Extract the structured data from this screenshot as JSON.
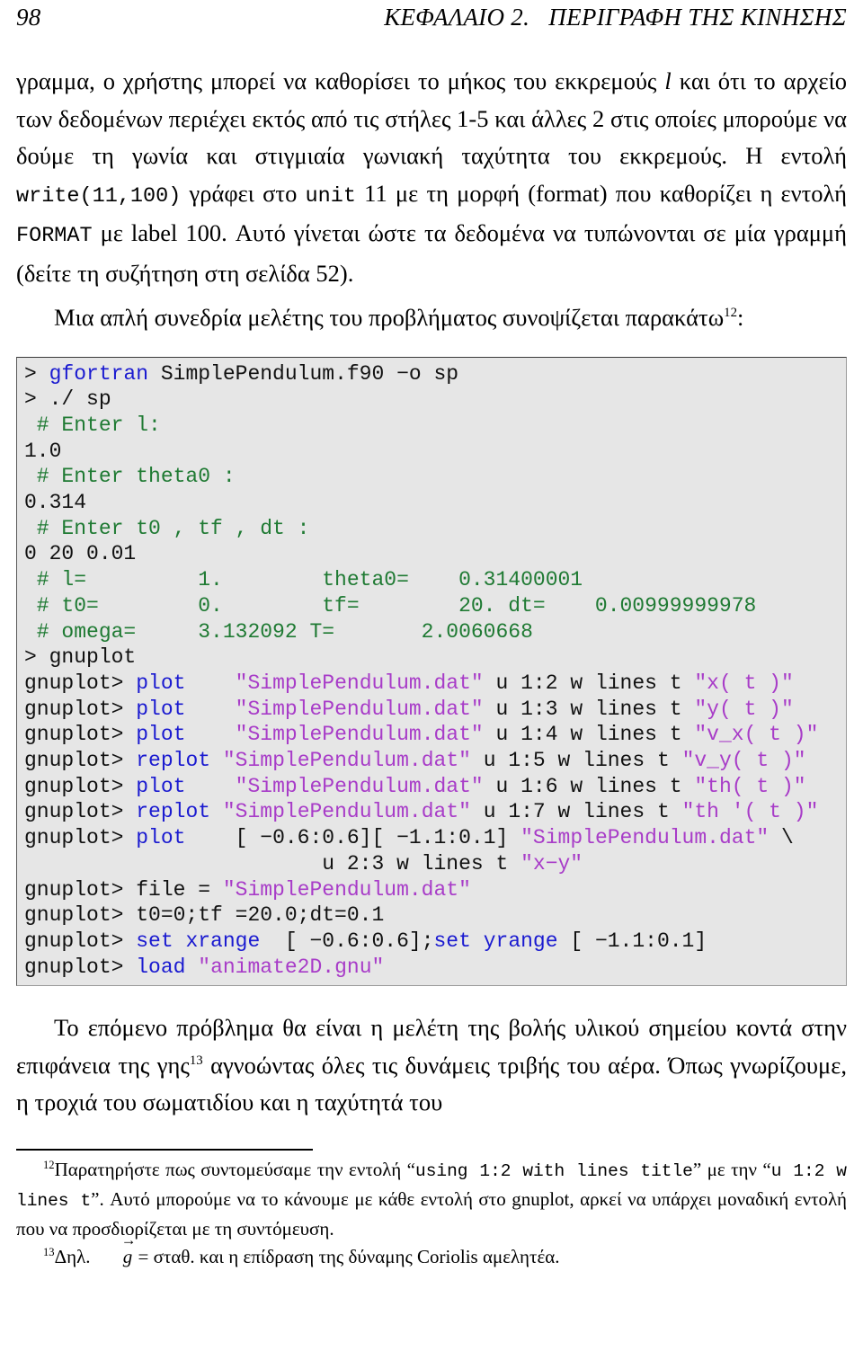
{
  "header": {
    "folio": "98",
    "chapter_title": "ΚΕΦΑΛΑΙΟ 2.   ΠΕΡΙΓΡΑΦΗ ΤΗΣ ΚΙΝΗΣΗΣ"
  },
  "body": {
    "para1_a": "γραμμα, ο χρήστης μπορεί να καθορίσει το μήκος του εκκρεμούς ",
    "para1_l": "l",
    "para1_b": " και ότι το αρχείο των δεδομένων περιέχει εκτός από τις στήλες 1-5 και άλλες 2 στις οποίες μπορούμε να δούμε τη γωνία και στιγμιαία γωνιακή ταχύτητα του εκκρεμούς. Η εντολή ",
    "para1_code1": "write(11,100)",
    "para1_c": " γράφει στο ",
    "para1_code2": "unit",
    "para1_d": " 11 με τη μορφή (format) που καθορίζει η εντολή ",
    "para1_code3": "FORMAT",
    "para1_e": " με label 100. Αυτό γίνεται ώστε τα δεδομένα να τυπώνονται σε μία γραμμή (δείτε τη συζήτηση στη σελίδα 52).",
    "para2_a": "Μια απλή συνεδρία μελέτης του προβλήματος συνοψίζεται παρακάτω",
    "para2_fn": "12",
    "para2_b": ":",
    "para3": "Το επόμενο πρόβλημα θα είναι η μελέτη της βολής υλικού σημείου κοντά στην επιφάνεια της γης",
    "para3_fn": "13",
    "para3_b": " αγνοώντας όλες τις δυνάμεις τριβής του αέρα. Όπως γνωρίζουμε, η τροχιά του σωματιδίου και η ταχύτητά του"
  },
  "code": {
    "lines": [
      [
        {
          "t": "> ",
          "c": "plain"
        },
        {
          "t": "gfortran",
          "c": "kw"
        },
        {
          "t": " SimplePendulum.f90 −o sp",
          "c": "plain"
        }
      ],
      [
        {
          "t": "> ./ sp",
          "c": "plain"
        }
      ],
      [
        {
          "t": " # Enter l:",
          "c": "cmt"
        }
      ],
      [
        {
          "t": "1.0",
          "c": "plain"
        }
      ],
      [
        {
          "t": " # Enter theta0 :",
          "c": "cmt"
        }
      ],
      [
        {
          "t": "0.314",
          "c": "plain"
        }
      ],
      [
        {
          "t": " # Enter t0 , tf , dt :",
          "c": "cmt"
        }
      ],
      [
        {
          "t": "0 20 0.01",
          "c": "plain"
        }
      ],
      [
        {
          "t": " # l=         1.        theta0=    0.31400001",
          "c": "cmt"
        }
      ],
      [
        {
          "t": " # t0=        0.        tf=        20. dt=    0.00999999978",
          "c": "cmt"
        }
      ],
      [
        {
          "t": " # omega=     3.132092 T=       2.0060668",
          "c": "cmt"
        }
      ],
      [
        {
          "t": "> gnuplot",
          "c": "plain"
        }
      ],
      [
        {
          "t": "gnuplot> ",
          "c": "plain"
        },
        {
          "t": "plot",
          "c": "kw"
        },
        {
          "t": "    ",
          "c": "plain"
        },
        {
          "t": "\"SimplePendulum.dat\"",
          "c": "str"
        },
        {
          "t": " u 1:2 w lines t ",
          "c": "plain"
        },
        {
          "t": "\"x( t )\"",
          "c": "str"
        }
      ],
      [
        {
          "t": "gnuplot> ",
          "c": "plain"
        },
        {
          "t": "plot",
          "c": "kw"
        },
        {
          "t": "    ",
          "c": "plain"
        },
        {
          "t": "\"SimplePendulum.dat\"",
          "c": "str"
        },
        {
          "t": " u 1:3 w lines t ",
          "c": "plain"
        },
        {
          "t": "\"y( t )\"",
          "c": "str"
        }
      ],
      [
        {
          "t": "gnuplot> ",
          "c": "plain"
        },
        {
          "t": "plot",
          "c": "kw"
        },
        {
          "t": "    ",
          "c": "plain"
        },
        {
          "t": "\"SimplePendulum.dat\"",
          "c": "str"
        },
        {
          "t": " u 1:4 w lines t ",
          "c": "plain"
        },
        {
          "t": "\"v_x( t )\"",
          "c": "str"
        }
      ],
      [
        {
          "t": "gnuplot> ",
          "c": "plain"
        },
        {
          "t": "replot",
          "c": "kw"
        },
        {
          "t": " ",
          "c": "plain"
        },
        {
          "t": "\"SimplePendulum.dat\"",
          "c": "str"
        },
        {
          "t": " u 1:5 w lines t ",
          "c": "plain"
        },
        {
          "t": "\"v_y( t )\"",
          "c": "str"
        }
      ],
      [
        {
          "t": "gnuplot> ",
          "c": "plain"
        },
        {
          "t": "plot",
          "c": "kw"
        },
        {
          "t": "    ",
          "c": "plain"
        },
        {
          "t": "\"SimplePendulum.dat\"",
          "c": "str"
        },
        {
          "t": " u 1:6 w lines t ",
          "c": "plain"
        },
        {
          "t": "\"th( t )\"",
          "c": "str"
        }
      ],
      [
        {
          "t": "gnuplot> ",
          "c": "plain"
        },
        {
          "t": "replot",
          "c": "kw"
        },
        {
          "t": " ",
          "c": "plain"
        },
        {
          "t": "\"SimplePendulum.dat\"",
          "c": "str"
        },
        {
          "t": " u 1:7 w lines t ",
          "c": "plain"
        },
        {
          "t": "\"th '( t )\"",
          "c": "str"
        }
      ],
      [
        {
          "t": "gnuplot> ",
          "c": "plain"
        },
        {
          "t": "plot",
          "c": "kw"
        },
        {
          "t": "    [ −0.6:0.6][ −1.1:0.1] ",
          "c": "plain"
        },
        {
          "t": "\"SimplePendulum.dat\"",
          "c": "str"
        },
        {
          "t": " \\",
          "c": "plain"
        }
      ],
      [
        {
          "t": "                        u 2:3 w lines t ",
          "c": "plain"
        },
        {
          "t": "\"x−y\"",
          "c": "str"
        }
      ],
      [
        {
          "t": "gnuplot> file = ",
          "c": "plain"
        },
        {
          "t": "\"SimplePendulum.dat\"",
          "c": "str"
        }
      ],
      [
        {
          "t": "gnuplot> t0=0;tf =20.0;dt=0.1",
          "c": "plain"
        }
      ],
      [
        {
          "t": "gnuplot> ",
          "c": "plain"
        },
        {
          "t": "set xrange",
          "c": "kw"
        },
        {
          "t": "  [ −0.6:0.6];",
          "c": "plain"
        },
        {
          "t": "set yrange",
          "c": "kw"
        },
        {
          "t": " [ −1.1:0.1]",
          "c": "plain"
        }
      ],
      [
        {
          "t": "gnuplot> ",
          "c": "plain"
        },
        {
          "t": "load",
          "c": "kw"
        },
        {
          "t": " ",
          "c": "plain"
        },
        {
          "t": "\"animate2D.gnu\"",
          "c": "str"
        }
      ]
    ]
  },
  "footnotes": {
    "fn12_num": "12",
    "fn12_a": "Παρατηρήστε πως συντομεύσαμε την εντολή “",
    "fn12_code1": "using 1:2 with lines title",
    "fn12_b": "” με την “",
    "fn12_code2": "u 1:2 w lines t",
    "fn12_c": "”. Αυτό μπορούμε να το κάνουμε με κάθε εντολή στο gnuplot, αρκεί να υπάρχει μοναδική εντολή που να προσδιορίζεται με τη συντόμευση.",
    "fn13_num": "13",
    "fn13_a": "Δηλ. ",
    "fn13_g": "g",
    "fn13_b": " = σταθ. και η επίδραση της δύναμης Coriolis αμελητέα."
  },
  "colors": {
    "keyword": "#1a1ad0",
    "comment": "#1f7a33",
    "string": "#a83cc8",
    "code_bg": "#e6e6e6",
    "text": "#000000"
  }
}
